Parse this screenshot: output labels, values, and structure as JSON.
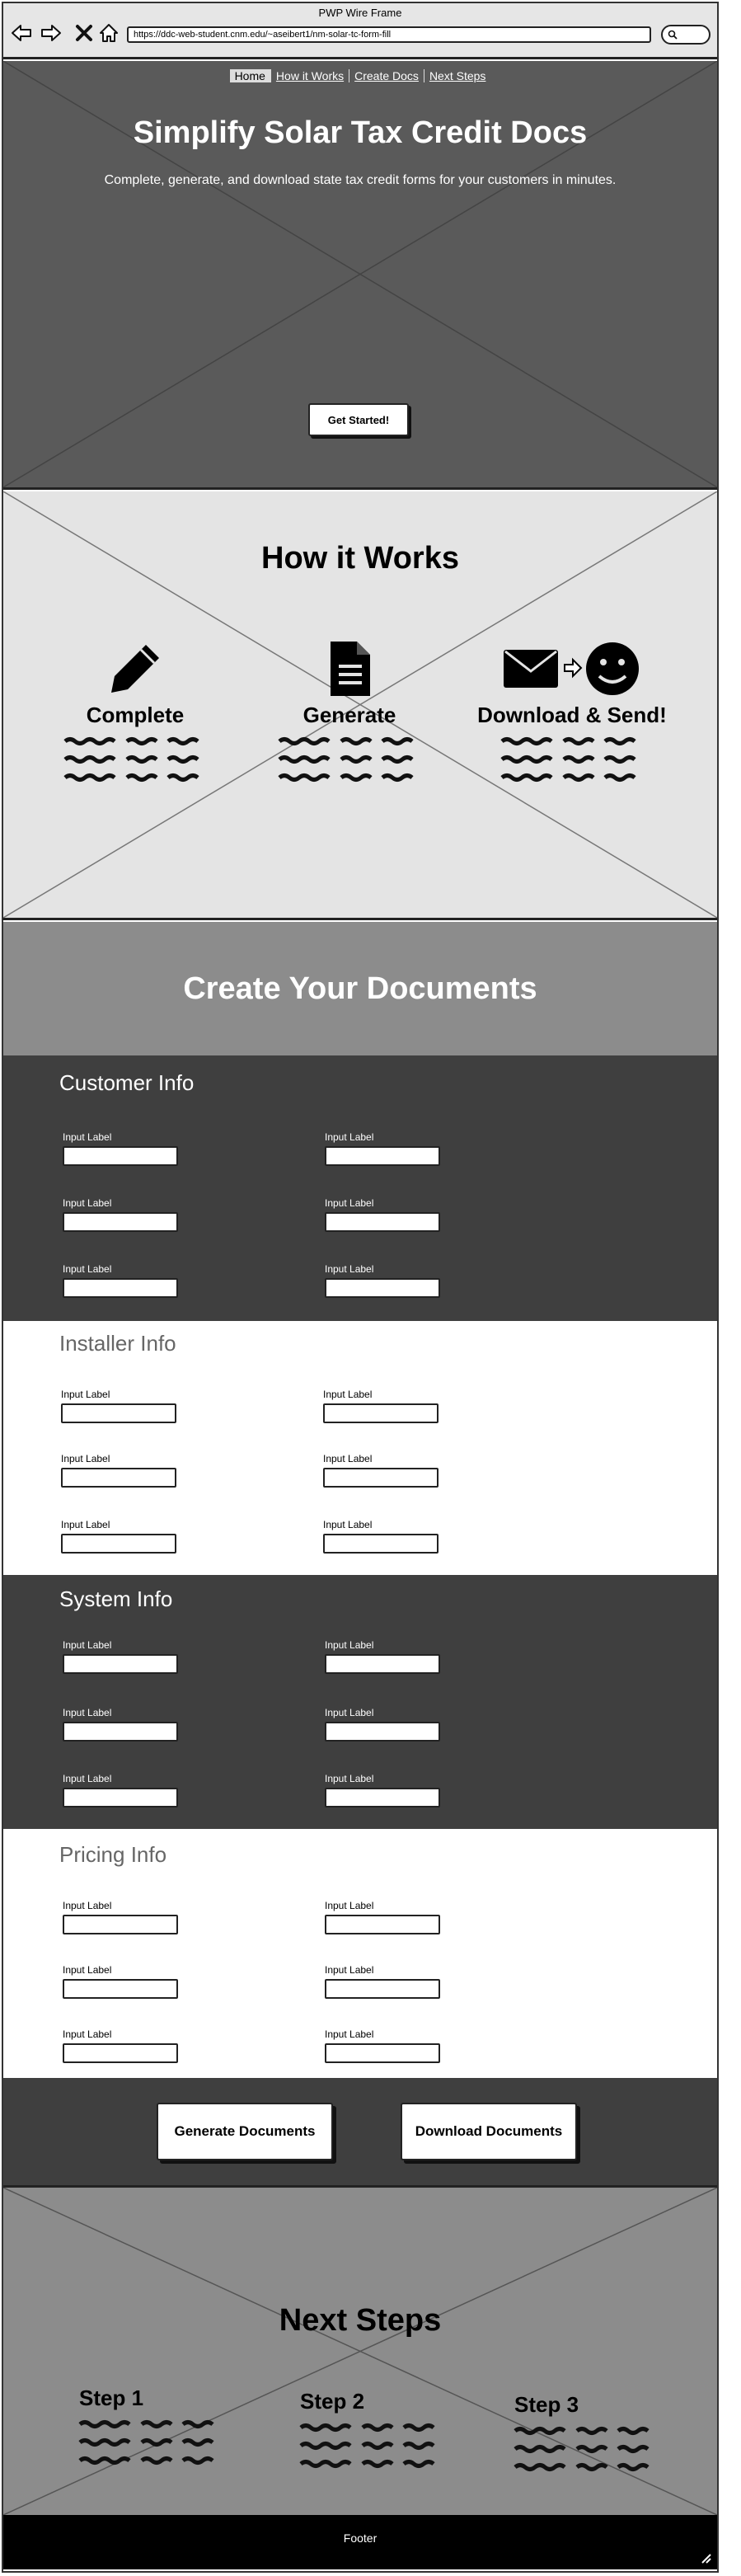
{
  "window": {
    "title": "PWP Wire Frame",
    "url": "https://ddc-web-student.cnm.edu/~aseibert1/nm-solar-tc-form-fill"
  },
  "nav": {
    "items": [
      "Home",
      "How it Works",
      "Create Docs",
      "Next Steps"
    ]
  },
  "hero": {
    "title": "Simplify Solar Tax Credit Docs",
    "subtitle": "Complete, generate, and download state tax credit forms for your customers in minutes.",
    "cta": "Get Started!"
  },
  "how": {
    "title": "How it Works",
    "steps": [
      {
        "name": "Complete",
        "icon": "pencil-icon"
      },
      {
        "name": "Generate",
        "icon": "document-icon"
      },
      {
        "name": "Download & Send!",
        "icon": "envelope-arrow-smiley-icon"
      }
    ]
  },
  "create": {
    "title": "Create Your Documents",
    "sections": [
      {
        "title": "Customer Info",
        "theme": "dark",
        "labels": [
          "Input Label",
          "Input Label",
          "Input Label",
          "Input Label",
          "Input Label",
          "Input Label"
        ]
      },
      {
        "title": "Installer Info",
        "theme": "light",
        "labels": [
          "Input Label",
          "Input Label",
          "Input Label",
          "Input Label",
          "Input Label",
          "Input Label"
        ]
      },
      {
        "title": "System Info",
        "theme": "dark",
        "labels": [
          "Input Label",
          "Input Label",
          "Input Label",
          "Input Label",
          "Input Label",
          "Input Label"
        ]
      },
      {
        "title": "Pricing Info",
        "theme": "light",
        "labels": [
          "Input Label",
          "Input Label",
          "Input Label",
          "Input Label",
          "Input Label",
          "Input Label"
        ]
      }
    ],
    "generate_button": "Generate Documents",
    "download_button": "Download Documents"
  },
  "next": {
    "title": "Next Steps",
    "steps": [
      "Step 1",
      "Step 2",
      "Step 3"
    ]
  },
  "footer": {
    "text": "Footer"
  },
  "colors": {
    "hero_bg": "#5a5a5a",
    "how_bg": "#e4e4e4",
    "create_head_bg": "#8c8c8c",
    "dark_section_bg": "#3f3f3f",
    "footer_bg": "#000000"
  }
}
